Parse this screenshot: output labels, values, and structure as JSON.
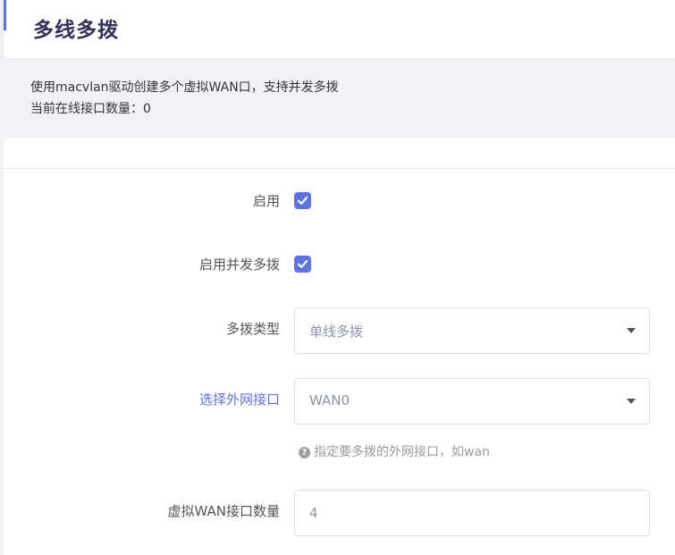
{
  "header": {
    "title": "多线多拨"
  },
  "description": {
    "line1": "使用macvlan驱动创建多个虚拟WAN口，支持并发多拨",
    "line2": "当前在线接口数量：0"
  },
  "form": {
    "enable": {
      "label": "启用",
      "checked": true
    },
    "concurrent": {
      "label": "启用并发多拨",
      "checked": true
    },
    "dial_type": {
      "label": "多拨类型",
      "value": "单线多拨"
    },
    "wan_interface": {
      "label": "选择外网接口",
      "value": "WAN0",
      "help_icon": "question-circle-icon",
      "help": "指定要多拨的外网接口，如wan"
    },
    "virtual_count": {
      "label": "虚拟WAN接口数量",
      "value": "4"
    }
  },
  "colors": {
    "accent": "#5e72e4",
    "title": "#32325d",
    "background": "#f0f2f5"
  }
}
